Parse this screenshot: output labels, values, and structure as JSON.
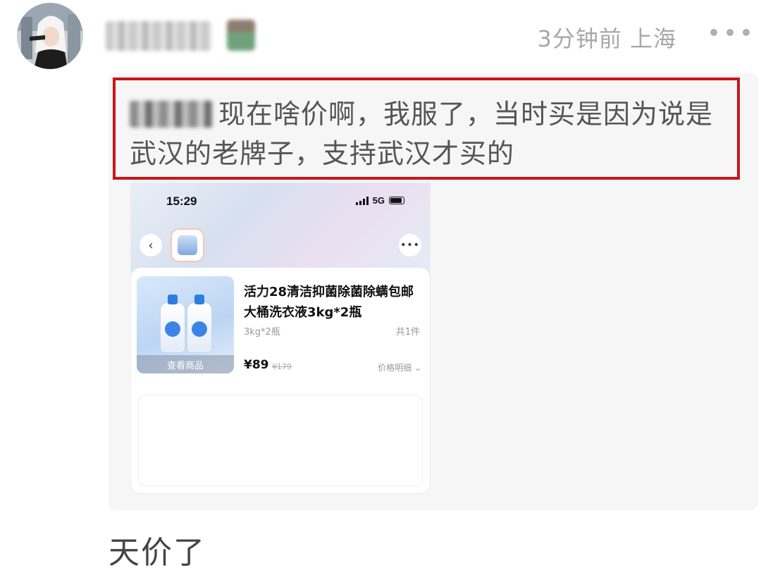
{
  "post": {
    "meta": "3分钟前 上海",
    "quoted_text": "现在啥价啊，我服了，当时买是因为说是武汉的老牌子，支持武汉才买的",
    "reply_text": "天价了"
  },
  "screenshot": {
    "status_time": "15:29",
    "network": "5G",
    "product_title": "活力28清洁抑菌除菌除螨包邮大桶洗衣液3kg*2瓶",
    "spec": "3kg*2瓶",
    "count": "共1件",
    "price": "¥89",
    "original_price": "¥179",
    "price_detail": "价格明细 ⌄",
    "view_goods": "查看商品"
  },
  "icons": {
    "more": "more-dots-icon",
    "back": "chevron-left-icon",
    "signal": "signal-bars-icon",
    "battery": "battery-icon"
  },
  "colors": {
    "highlight_border": "#c9151e",
    "meta_gray": "#a8a8a8"
  }
}
